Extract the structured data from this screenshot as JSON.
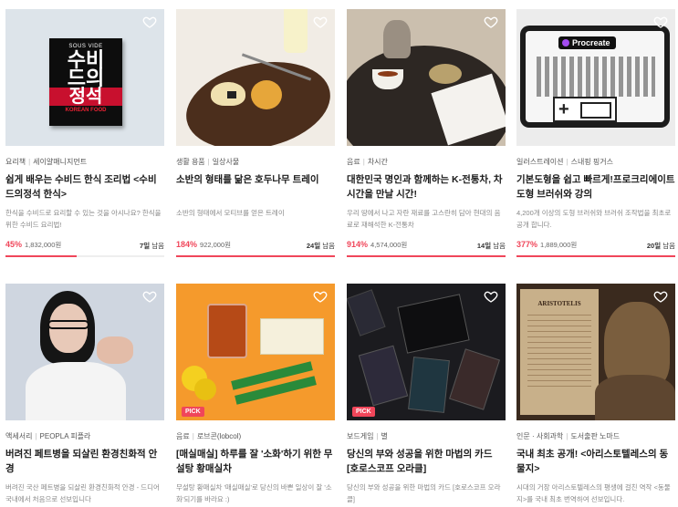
{
  "row1": [
    {
      "category": "요리책",
      "maker": "세이얄매니지먼트",
      "title": "쉽게 배우는 수비드 한식 조리법 <수비드의정석 한식>",
      "desc": "한식을 수비드로 요리할 수 있는 것을 아시나요? 한식을 위한 수비드 요리법!",
      "percent": "45%",
      "amount": "1,832,000원",
      "days": "7일",
      "days_suffix": " 남음",
      "progress": 0.45,
      "book_top": "SOUS VIDE",
      "book_main1": "수비",
      "book_main2": "드의",
      "book_main3": "정석",
      "book_sub": "KOREAN FOOD"
    },
    {
      "category": "생활 용품",
      "maker": "일상사물",
      "title": "소반의 형태를 닮은 호두나무 트레이",
      "desc": "소반의 형태에서 모티브를 얻은 트레이",
      "percent": "184%",
      "amount": "922,000원",
      "days": "24일",
      "days_suffix": " 남음",
      "progress": 1
    },
    {
      "category": "음료",
      "maker": "차시간",
      "title": "대한민국 명인과 함께하는 K-전통차, 차 시간을 만날 시간!",
      "desc": "우리 땅에서 나고 자란 재료를 고스란히 담아 현대의 음료로 재해석한 K-전통차",
      "percent": "914%",
      "amount": "4,574,000원",
      "days": "14일",
      "days_suffix": " 남음",
      "progress": 1
    },
    {
      "category": "일러스트레이션",
      "maker": "스내핑 핑거스",
      "title": "기본도형을 쉽고 빠르게!프로크리에이트 도형 브러쉬와 강의",
      "desc": "4,200개 이상의 도형 브러쉬와 브러쉬 조작법을 최초로 공개 합니다.",
      "percent": "377%",
      "amount": "1,889,000원",
      "days": "20일",
      "days_suffix": " 남음",
      "progress": 1,
      "app_name": "Procreate"
    }
  ],
  "row2": [
    {
      "category": "액세서리",
      "maker": "PEOPLA 피플라",
      "title": "버려진 페트병을 되살린 환경친화적 안경",
      "desc": "버려진 국산 페트병을 되살린 환경친화적 안경 - 드디어 국내에서 처음으로 선보입니다",
      "pick": false
    },
    {
      "category": "음료",
      "maker": "로브콘(lobcol)",
      "title": "[매실매실] 하루를 잘 '소화'하기 위한 무설탕 황매실차",
      "desc": "무설탕 황매실차 '매실매실'로 당신의 바쁜 일상이 잘 '소화'되기를 바라요 :)",
      "pick": true,
      "pick_label": "PICK"
    },
    {
      "category": "보드게임",
      "maker": "별",
      "title": "당신의 부와 성공을 위한 마법의 카드 [호로스코프 오라클]",
      "desc": "당신의 부와 성공을 위한 마법의 카드 [호로스코프 오라클]",
      "pick": true,
      "pick_label": "PICK"
    },
    {
      "category": "인문 · 사회과학",
      "maker": "도서출판 노마드",
      "title": "국내 최초 공개! <아리스토텔레스의 동물지>",
      "desc": "시대의 거장 아리스토텔레스의 평생에 걸친 역작 <동물지>를 국내 최초 번역하여 선보입니다.",
      "pick": false,
      "book_text": "ARISTOTELIS"
    }
  ],
  "colors": {
    "accent": "#f0465a"
  },
  "icons": {
    "like": "heart-outline-icon"
  }
}
